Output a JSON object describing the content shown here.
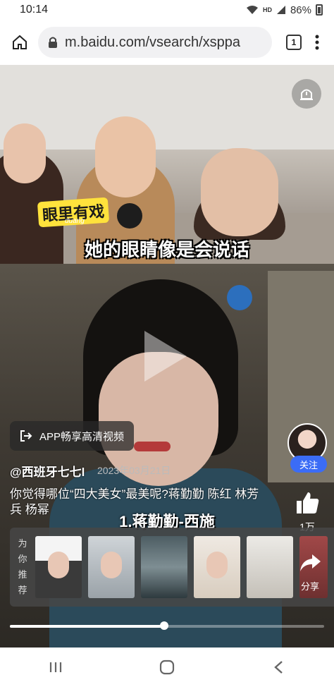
{
  "status_bar": {
    "time": "10:14",
    "network": "HD",
    "battery": "86%"
  },
  "browser": {
    "url": "m.baidu.com/vsearch/xsppa",
    "tab_count": "1"
  },
  "top_video": {
    "sticker": "眼里有戏",
    "sticker_sub": "duang",
    "subtitle": "她的眼睛像是会说话"
  },
  "main_video": {
    "app_button": "APP畅享高清视频",
    "author": "@西班牙七七l",
    "date": "2023年03月21日",
    "description": "你觉得哪位“四大美女”最美呢?蒋勤勤 陈红 林芳兵 杨幂",
    "caption": "1.蒋勤勤-西施",
    "follow": "关注",
    "likes": "1万",
    "share": "分享",
    "progress_percent": 49
  },
  "recommend": {
    "label": [
      "为",
      "你",
      "推",
      "荐"
    ]
  },
  "icons": {
    "home": "home-icon",
    "lock": "lock-icon",
    "menu": "more-vert-icon",
    "alert": "alert-icon",
    "like": "thumbs-up-icon",
    "share": "share-icon",
    "app": "exit-icon",
    "recents": "recents-icon",
    "home_nav": "home-circle-icon",
    "back": "back-icon"
  }
}
